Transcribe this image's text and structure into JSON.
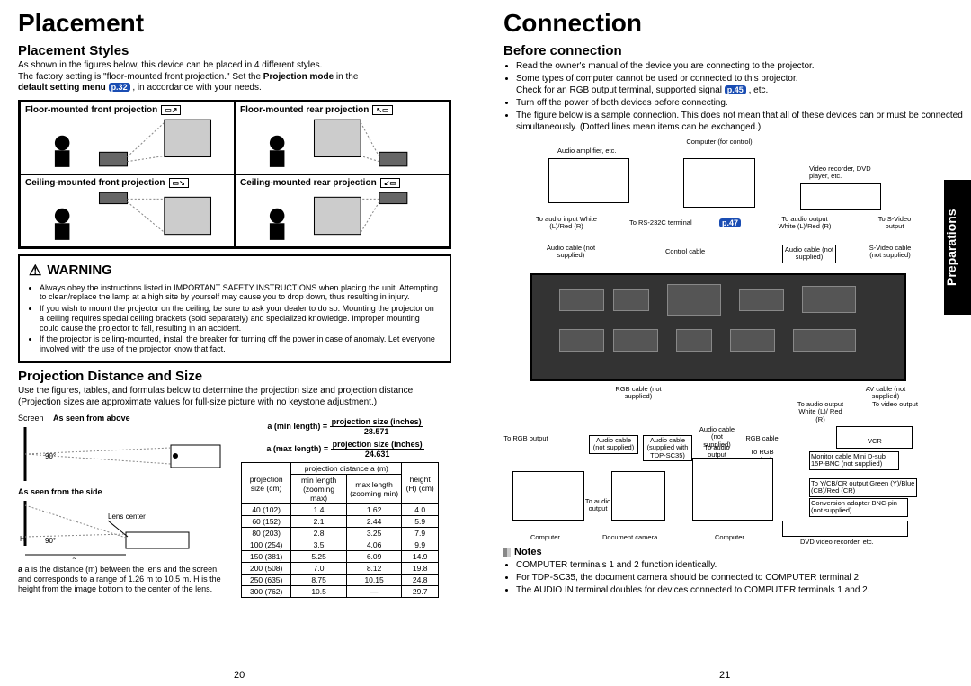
{
  "left_page": {
    "title": "Placement",
    "section_styles": "Placement Styles",
    "styles_intro1": "As shown in the figures below, this device can be placed in 4 different styles.",
    "styles_intro2a": "The factory setting is \"floor-mounted front projection.\" Set the ",
    "styles_intro2b": "Projection mode",
    "styles_intro2c": " in the ",
    "styles_intro3a": "default setting menu ",
    "ref_p32": "p.32",
    "styles_intro3b": " , in accordance with your needs.",
    "style_labels": {
      "ff": "Floor-mounted front projection",
      "fr": "Floor-mounted rear projection",
      "cf": "Ceiling-mounted front projection",
      "cr": "Ceiling-mounted rear projection"
    },
    "warning_title": "WARNING",
    "warning_items": [
      "Always obey the instructions listed in IMPORTANT SAFETY INSTRUCTIONS when placing the unit. Attempting to clean/replace the lamp at a high site by yourself may cause you to drop down, thus resulting in injury.",
      "If you wish to mount the projector on the ceiling, be sure to ask your dealer to do so. Mounting the projector on a ceiling requires special ceiling brackets (sold separately) and specialized knowledge. Improper mounting could cause the projector to fall, resulting in an accident.",
      "If the projector is ceiling-mounted, install the breaker for turning off the power in case of anomaly. Let everyone involved with the use of the projector know that fact."
    ],
    "section_proj": "Projection Distance and Size",
    "proj_intro": "Use the figures, tables, and formulas below to determine the projection size and projection distance. (Projection sizes are approximate values for full-size picture with no keystone adjustment.)",
    "screen_label": "Screen",
    "above_label": "As seen from above",
    "side_label": "As seen from the side",
    "lens_center": "Lens center",
    "angle_90": "90°",
    "dim_a": "a",
    "dim_h": "H",
    "formula_min_label": "a (min length) =",
    "formula_min_num": "projection size (inches)",
    "formula_min_den": "28.571",
    "formula_max_label": "a (max length) =",
    "formula_max_num": "projection size (inches)",
    "formula_max_den": "24.631",
    "table_headers": {
      "proj_size": "projection size (cm)",
      "dist_hdr": "projection distance a (m)",
      "min_len": "min length (zooming max)",
      "max_len": "max length (zooming min)",
      "height": "height (H) (cm)"
    },
    "table_rows": [
      [
        "40 (102)",
        "1.4",
        "1.62",
        "4.0"
      ],
      [
        "60 (152)",
        "2.1",
        "2.44",
        "5.9"
      ],
      [
        "80 (203)",
        "2.8",
        "3.25",
        "7.9"
      ],
      [
        "100 (254)",
        "3.5",
        "4.06",
        "9.9"
      ],
      [
        "150 (381)",
        "5.25",
        "6.09",
        "14.9"
      ],
      [
        "200 (508)",
        "7.0",
        "8.12",
        "19.8"
      ],
      [
        "250 (635)",
        "8.75",
        "10.15",
        "24.8"
      ],
      [
        "300 (762)",
        "10.5",
        "—",
        "29.7"
      ]
    ],
    "footnote": "a is the distance (m) between the lens and the screen, and corresponds to a range of 1.26 m to 10.5 m. H is the height from the image bottom to the center of the lens.",
    "page_num": "20"
  },
  "right_page": {
    "title": "Connection",
    "section_before": "Before connection",
    "bullets": [
      "Read the owner's manual of the device you are connecting to the projector.",
      "Some types of computer cannot be used or connected to this projector.",
      "Turn off the power of both devices before connecting.",
      "The figure below is a sample connection. This does not mean that all of these devices can or must be connected simultaneously. (Dotted lines mean items can be exchanged.)"
    ],
    "check_line_a": "Check for an RGB output terminal, supported signal ",
    "ref_p45": "p.45",
    "check_line_b": " , etc.",
    "ref_p47": "p.47",
    "diagram_labels": {
      "audio_amp": "Audio amplifier, etc.",
      "computer_ctrl": "Computer (for control)",
      "video_rec": "Video recorder, DVD player, etc.",
      "to_audio_in": "To audio input White (L)/Red (R)",
      "to_rs232": "To RS-232C terminal",
      "to_audio_out": "To audio output White (L)/Red (R)",
      "to_svideo": "To S-Video output",
      "audio_cable_ns": "Audio cable (not supplied)",
      "control_cable": "Control cable",
      "svideo_cable_ns": "S-Video cable (not supplied)",
      "rgb_cable_ns": "RGB cable (not supplied)",
      "to_rgb_out": "To RGB output",
      "audio_cable_sup": "Audio cable (supplied with TDP-SC35)",
      "rgb_cable": "RGB cable",
      "to_audio_out2": "To audio output",
      "to_rgb_out2": "To RGB output",
      "av_cable_ns": "AV cable (not supplied)",
      "to_audio_out3": "To audio output White (L)/ Red (R)",
      "to_video_out": "To video output",
      "vcr": "VCR",
      "monitor_cable": "Monitor cable Mini D-sub 15P-BNC (not supplied)",
      "to_ycbcr": "To Y/CB/CR output Green (Y)/Blue (CB)/Red (CR)",
      "conv_adapter": "Conversion adapter BNC-pin (not supplied)",
      "computer": "Computer",
      "doc_camera": "Document camera",
      "dvd_rec": "DVD video recorder, etc.",
      "to_audio_out4": "To audio output"
    },
    "notes_title": "Notes",
    "notes": [
      "COMPUTER terminals 1 and 2 function identically.",
      "For TDP-SC35, the document camera should be connected to COMPUTER terminal 2.",
      "The AUDIO IN terminal doubles for devices connected to COMPUTER terminals 1 and 2."
    ],
    "page_num": "21",
    "side_tab": "Preparations"
  }
}
